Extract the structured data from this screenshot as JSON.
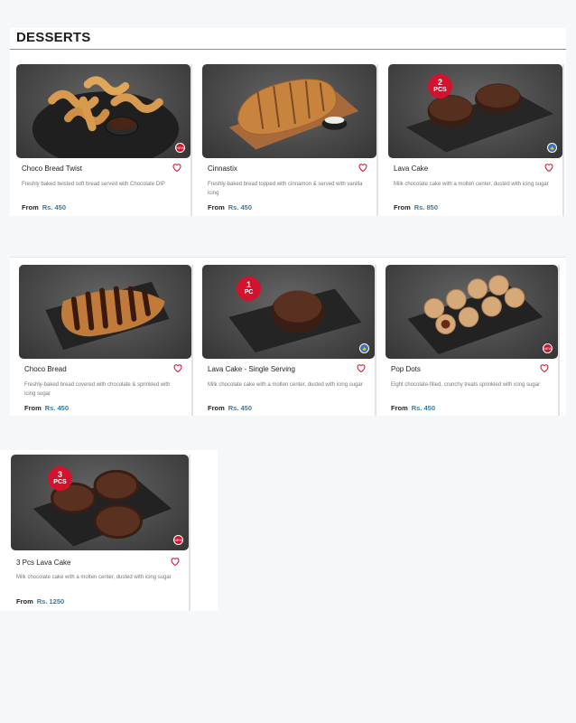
{
  "section": {
    "title": "DESSERTS"
  },
  "price_prefix": "From",
  "products": [
    {
      "name": "Choco Bread Twist",
      "description": "Freshly baked twisted soft bread served with Chocolate DIP",
      "price": "Rs. 450",
      "tag": "NEW"
    },
    {
      "name": "Cinnastix",
      "description": "Freshly-baked bread topped with cinnamon & served with vanilla icing",
      "price": "Rs. 450"
    },
    {
      "name": "Lava Cake",
      "description": "Milk chocolate cake with a molten center, dusted with icing sugar",
      "price": "Rs. 850",
      "badge_number": "2",
      "badge_unit": "PCS",
      "tag_icon": "thumbs-up-icon"
    },
    {
      "name": "Choco Bread",
      "description": "Freshly-baked bread covered with chocolate & sprinkled with icing sugar",
      "price": "Rs. 450"
    },
    {
      "name": "Lava Cake - Single Serving",
      "description": "Milk chocolate cake with a molten center, dusted with icing sugar",
      "price": "Rs. 450",
      "badge_number": "1",
      "badge_unit": "PC",
      "tag_icon": "thumbs-up-icon"
    },
    {
      "name": "Pop Dots",
      "description": "Eight chocolate-filled, crunchy treats sprinkled with icing sugar",
      "price": "Rs. 450",
      "tag": "NEW"
    },
    {
      "name": "3 Pcs Lava Cake",
      "description": "Milk chocolate cake with a molten center, dusted with icing sugar",
      "price": "Rs. 1250",
      "badge_number": "3",
      "badge_unit": "PCS",
      "tag": "NEW"
    }
  ],
  "colors": {
    "price": "#2a7fa8",
    "badge": "#d3122e",
    "heart": "#c8102e",
    "background": "#f6f7f9"
  }
}
